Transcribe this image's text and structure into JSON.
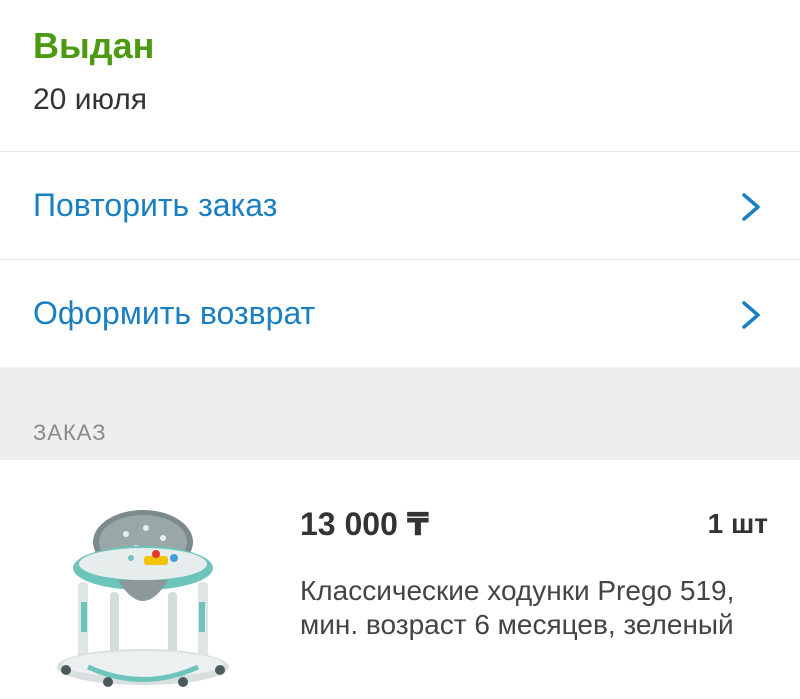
{
  "status": {
    "title": "Выдан",
    "date": "20 июля",
    "color": "#4c9a12"
  },
  "actions": [
    {
      "label": "Повторить заказ",
      "icon": "chevron-right-icon"
    },
    {
      "label": "Оформить возврат",
      "icon": "chevron-right-icon"
    }
  ],
  "section": {
    "label": "ЗАКАЗ"
  },
  "order_item": {
    "price": "13 000 ₸",
    "quantity": "1 шт",
    "name": "Классические ходунки Prego 519, мин. возраст 6 месяцев, зеленый",
    "image_icon": "baby-walker-image"
  },
  "colors": {
    "accent": "#1a7fc1",
    "divider": "#e6e6e6",
    "section_bg": "#eeeeee"
  }
}
